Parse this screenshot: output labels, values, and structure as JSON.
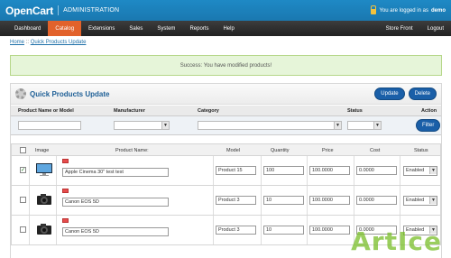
{
  "header": {
    "logo": "OpenCart",
    "title": "ADMINISTRATION",
    "login_text": "You are logged in as",
    "user": "demo"
  },
  "nav": {
    "items": [
      "Dashboard",
      "Catalog",
      "Extensions",
      "Sales",
      "System",
      "Reports",
      "Help"
    ],
    "active": "Catalog",
    "right": [
      "Store Front",
      "Logout"
    ]
  },
  "breadcrumb": [
    "Home",
    "Quick Products Update"
  ],
  "success": "Success: You have modified products!",
  "box": {
    "title": "Quick Products Update",
    "update_label": "Update",
    "delete_label": "Delete"
  },
  "filter": {
    "columns": [
      "Product Name or Model",
      "Manufacturer",
      "Category",
      "Status",
      "Action"
    ],
    "filter_label": "Filter"
  },
  "table": {
    "columns": [
      "Image",
      "Product Name:",
      "Model",
      "Quantity",
      "Price",
      "Cost",
      "Status"
    ],
    "rows": [
      {
        "checked": true,
        "name": "Apple Cinema 30\"  test test",
        "model": "Product 15",
        "quantity": "100",
        "price": "100.0000",
        "cost": "0.0000",
        "status": "Enabled",
        "image": "monitor-icon"
      },
      {
        "checked": false,
        "name": "Canon EOS 5D",
        "model": "Product 3",
        "quantity": "10",
        "price": "100.0000",
        "cost": "0.0000",
        "status": "Enabled",
        "image": "camera-icon"
      },
      {
        "checked": false,
        "name": "Canon EOS 5D",
        "model": "Product 3",
        "quantity": "10",
        "price": "100.0000",
        "cost": "0.0000",
        "status": "Enabled",
        "image": "camera-icon"
      }
    ]
  },
  "watermark": "ArtIce",
  "colors": {
    "header": "#1e89c5",
    "nav": "#2e2e2e",
    "nav_active": "#e2622b",
    "button": "#1a5fa8",
    "success_bg": "#e6f5d9"
  }
}
